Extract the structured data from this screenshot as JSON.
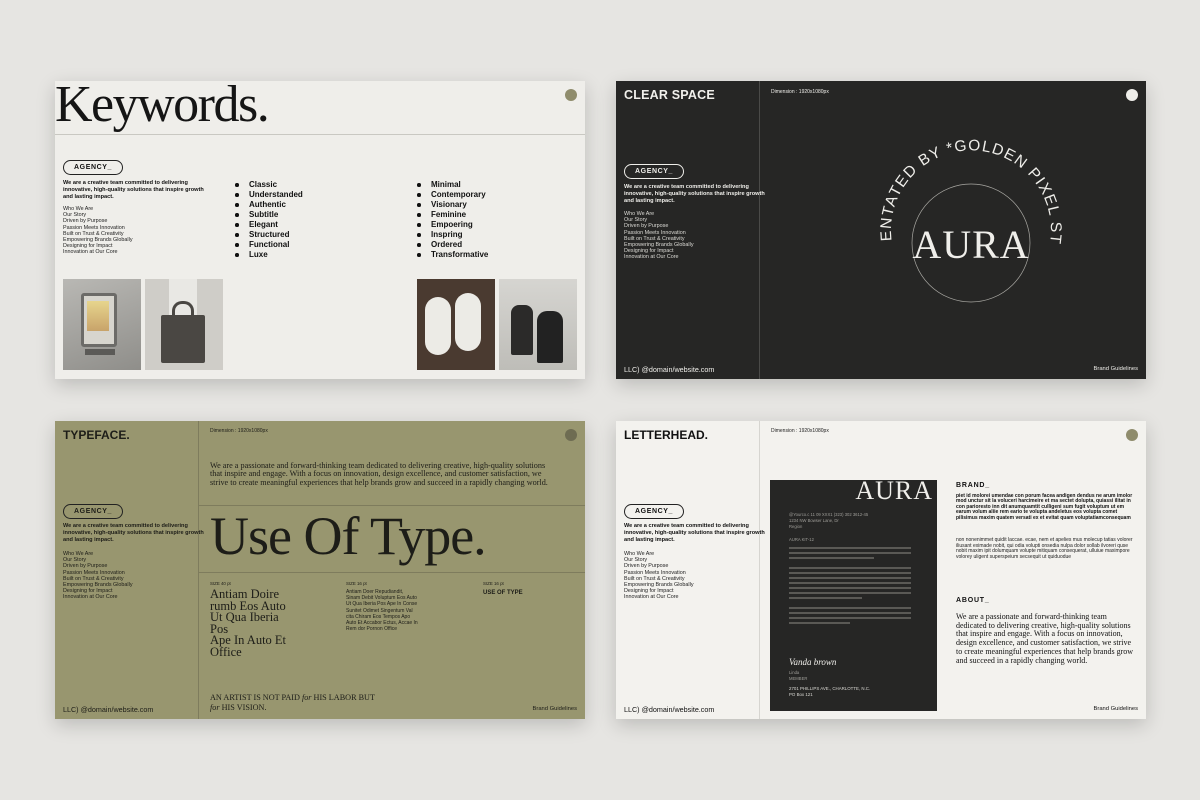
{
  "common": {
    "agency": "AGENCY_",
    "intro": "We are a creative team committed to delivering innovative, high-quality solutions that inspire growth and lasting impact.",
    "menu": [
      "Who We Are",
      "Our Story",
      "Driven by Purpose",
      "Passion Meets Innovation",
      "Built on Trust & Creativity",
      "Empowering Brands Globally",
      "Designing for Impact",
      "Innovation at Our Core"
    ],
    "footer_left": "LLC) @domain/website.com",
    "footer_right": "Brand Guidelines",
    "dimension": "Dimension : 1920x1080px"
  },
  "slide_keywords": {
    "title": "Keywords.",
    "col1": [
      "Classic",
      "Understanded",
      "Authentic",
      "Subtitle",
      "Elegant",
      "Structured",
      "Functional",
      "Luxe"
    ],
    "col2": [
      "Minimal",
      "Contemporary",
      "Visionary",
      "Feminine",
      "Empoering",
      "Inspring",
      "Ordered",
      "Transformative"
    ]
  },
  "slide_clearspace": {
    "title": "CLEAR SPACE",
    "circle_text": "* PRESENTATED BY *GOLDEN PIXEL STUDIO *",
    "logo": "AURA"
  },
  "slide_typeface": {
    "title": "TYPEFACE.",
    "lead": "We are a passionate and forward-thinking team dedicated to delivering creative, high-quality solutions that inspire and engage. With a focus on innovation, design excellence, and customer satisfaction, we strive to create meaningful experiences that help brands grow and succeed in a rapidly changing world.",
    "display": "Use Of Type.",
    "size1": "SIZE 40 pt",
    "size2": "SIZE 16 pt",
    "size3": "SIZE 16 pt",
    "sample_large": [
      "Antiam Doire",
      "rumb Eos Auto",
      "Ut Qua Iberia",
      "Pos",
      "Ape In Auto Et",
      "Office"
    ],
    "sample_mid": [
      "Antiam Doer Repudiandit,",
      "Sinam Debit Voluptum Eos Auto",
      "Ut Qua Iberia Pos Ape In Conse",
      "Sunitet Odimet Singentum Val",
      "cita Chiram Eos Tempos Apo",
      "Auto Et Accabor Ectus, Accae In",
      "Rem dor Pornon Office"
    ],
    "use_of_type": "USE OF TYPE",
    "quote_line1": "AN ARTIST IS NOT PAID",
    "quote_for1": "for",
    "quote_line1b": "HIS LABOR BUT",
    "quote_for2": "for",
    "quote_line2": "HIS VISION."
  },
  "slide_letterhead": {
    "title": "LETTERHEAD.",
    "logo": "AURA",
    "contact1": "@Yourco.c   11 09 XXX1  (323) 302 3612-45",
    "contact2": "1234 NW Bowser Lane, Dr",
    "contact3": "Region",
    "kit": "AURA KIT-12",
    "signature": "Vanda brown",
    "sig_name": "Linda",
    "sig_role": "MEMBER",
    "address": "2701 PHILLIPS AVE., CHARLOTTE, N.C.",
    "po_box": "PO Box 121",
    "brand_heading": "BRAND_",
    "brand_bold": "piet id molorei umendae con porum facea andigen dendus ne arum imolor mod unctur sit la voluceri harcimeire et ma sectet dolupta, quiassi ilitat in con parioresto inn dit anumquamtit culligeni sum fugit voluptum ut em earum volum aliie rem eario te volupta andeletus eos volupta comet pilisimus maxim quatem versati ex et evitat quam voluptatiamconsequam",
    "brand_body": "non nonenimmet quidit laccae. ecae, nem et apelies mus molecup tatias volorer iliusant eximade nobit, qui odia volupti onsedia nulpa dolor sollab ilvoreri quse nobit maxim ipit dolumquam volupte mitiquam consequerat, ulluiue maximpore volorey uligent superspeium secsequit ut quiduodue",
    "about_heading": "ABOUT_",
    "about_body": "We are a passionate and forward-thinking team dedicated to delivering creative, high-quality solutions that inspire and engage. With a focus on innovation, design excellence, and customer satisfaction, we strive to create meaningful experiences that help brands grow and succeed in a rapidly changing world."
  },
  "colors": {
    "olive": "#98966f",
    "dark": "#262625",
    "cream": "#efeeea",
    "accent_dot": "#8f8c6c"
  }
}
